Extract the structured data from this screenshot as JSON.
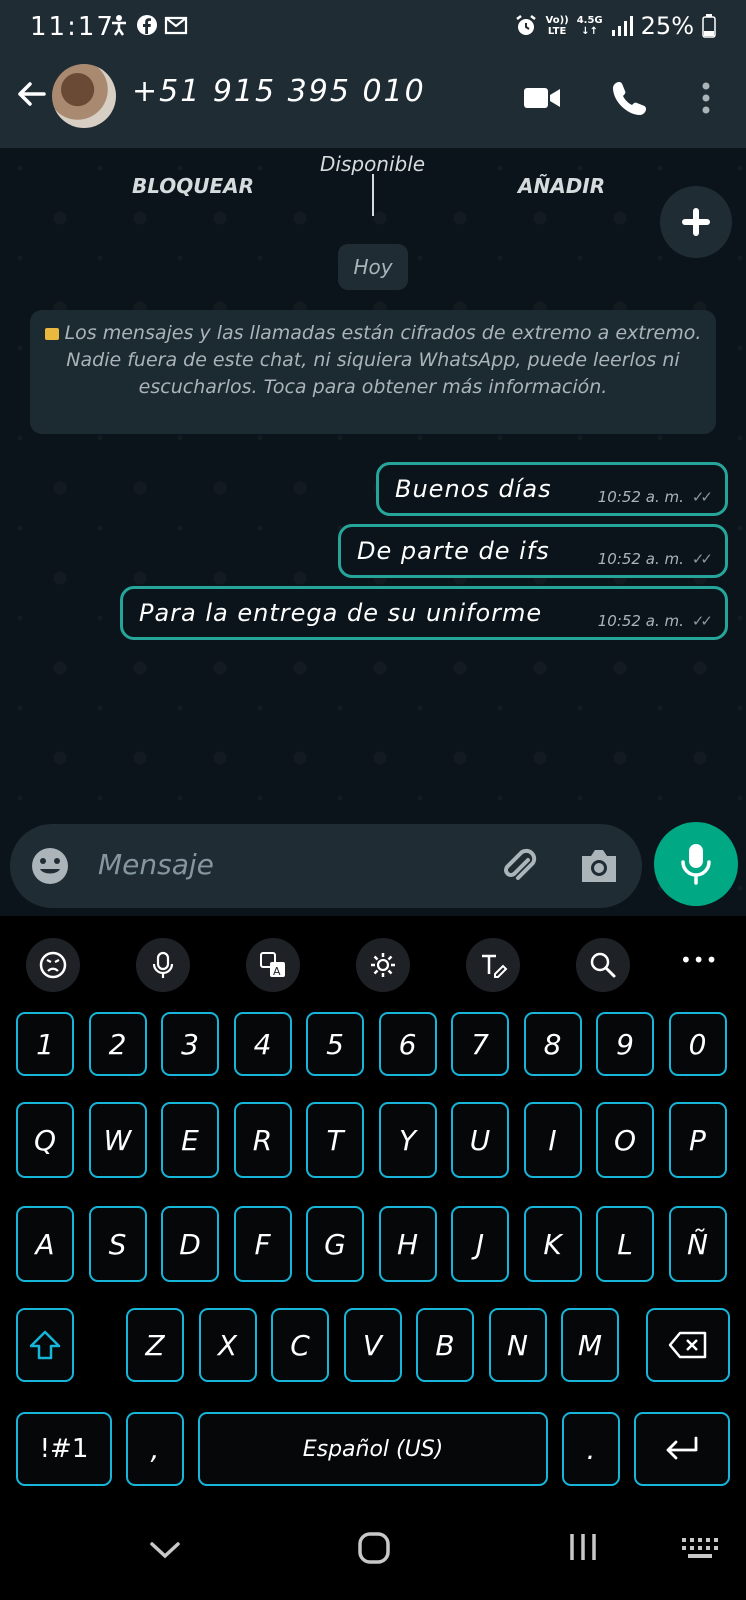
{
  "status_bar": {
    "time": "11:17",
    "network_top": "Vo))",
    "network_bottom": "LTE",
    "network_gen_top": "4.5G",
    "network_gen_bottom": "↓↑",
    "battery": "25%"
  },
  "header": {
    "contact_name": "+51 915 395 010"
  },
  "banner": {
    "block_label": "BLOQUEAR",
    "add_label": "AÑADIR",
    "status": "Disponible"
  },
  "chat": {
    "date_chip": "Hoy",
    "encryption_notice": "Los mensajes y las llamadas están cifrados de extremo a extremo. Nadie fuera de este chat, ni siquiera WhatsApp, puede leerlos ni escucharlos. Toca para obtener más información.",
    "messages": [
      {
        "text": "Buenos días",
        "time": "10:52 a. m."
      },
      {
        "text": "De parte de ifs",
        "time": "10:52 a. m."
      },
      {
        "text": "Para la entrega de su uniforme",
        "time": "10:52 a. m."
      }
    ]
  },
  "composer": {
    "placeholder": "Mensaje"
  },
  "keyboard": {
    "row_numbers": [
      "1",
      "2",
      "3",
      "4",
      "5",
      "6",
      "7",
      "8",
      "9",
      "0"
    ],
    "row_top": [
      "Q",
      "W",
      "E",
      "R",
      "T",
      "Y",
      "U",
      "I",
      "O",
      "P"
    ],
    "row_middle": [
      "A",
      "S",
      "D",
      "F",
      "G",
      "H",
      "J",
      "K",
      "L",
      "Ñ"
    ],
    "row_bottom": [
      "Z",
      "X",
      "C",
      "V",
      "B",
      "N",
      "M"
    ],
    "symbols_key": "!#1",
    "comma_key": ",",
    "space_label": "Español (US)",
    "period_key": ".",
    "more_label": "•••"
  },
  "colors": {
    "accent_green": "#00a884",
    "key_border": "#17b5d9",
    "bubble_border": "#26a69a",
    "header_bg": "#1f2c34"
  }
}
